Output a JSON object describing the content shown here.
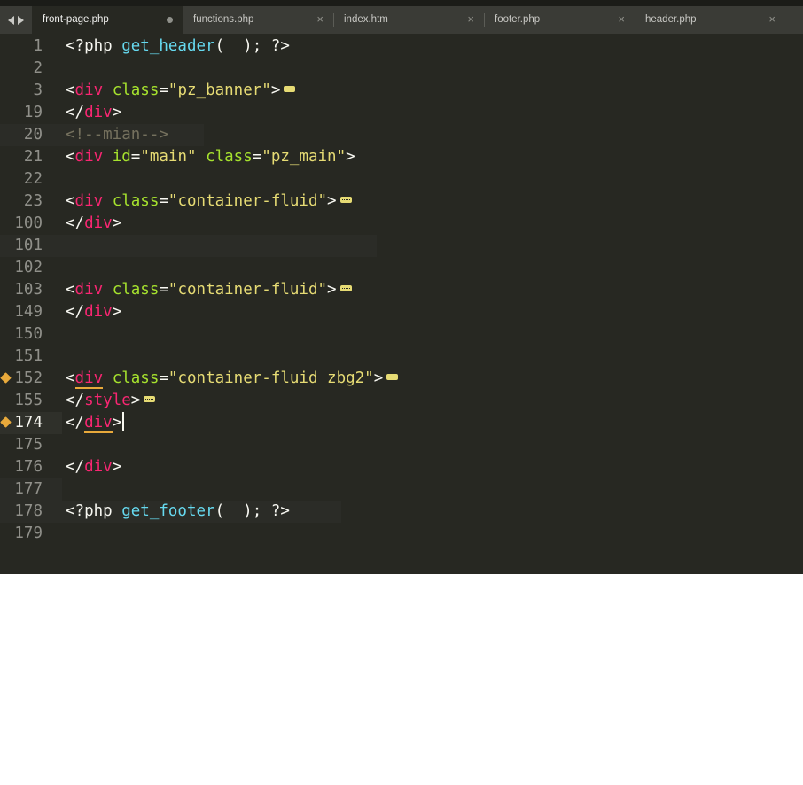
{
  "tabs": [
    {
      "label": "front-page.php",
      "active": true,
      "modified": true
    },
    {
      "label": "functions.php",
      "active": false,
      "modified": false
    },
    {
      "label": "index.htm",
      "active": false,
      "modified": false
    },
    {
      "label": "footer.php",
      "active": false,
      "modified": false
    },
    {
      "label": "header.php",
      "active": false,
      "modified": false
    }
  ],
  "close_glyph": "×",
  "line_numbers": [
    "1",
    "2",
    "3",
    "19",
    "20",
    "21",
    "22",
    "23",
    "100",
    "101",
    "102",
    "103",
    "149",
    "150",
    "151",
    "152",
    "155",
    "174",
    "175",
    "176",
    "177",
    "178",
    "179"
  ],
  "code": {
    "l1": {
      "open": "<?php ",
      "fn": "get_header",
      "rest": "(  ); ?>"
    },
    "l3": {
      "lt": "<",
      "tag": "div",
      "attr": " class",
      "eq": "=",
      "str": "\"pz_banner\"",
      "gt": ">"
    },
    "l19": {
      "lt": "</",
      "tag": "div",
      "gt": ">"
    },
    "l20": {
      "comment": "<!--mian-->"
    },
    "l21": {
      "lt": "<",
      "tag": "div",
      "attr1": " id",
      "eq1": "=",
      "str1": "\"main\"",
      "attr2": " class",
      "eq2": "=",
      "str2": "\"pz_main\"",
      "gt": ">"
    },
    "l23": {
      "lt": "<",
      "tag": "div",
      "attr": " class",
      "eq": "=",
      "str": "\"container-fluid\"",
      "gt": ">"
    },
    "l100": {
      "lt": "</",
      "tag": "div",
      "gt": ">"
    },
    "l103": {
      "lt": "<",
      "tag": "div",
      "attr": " class",
      "eq": "=",
      "str": "\"container-fluid\"",
      "gt": ">"
    },
    "l149": {
      "lt": "</",
      "tag": "div",
      "gt": ">"
    },
    "l152": {
      "lt": "<",
      "tag": "div",
      "attr": " class",
      "eq": "=",
      "str": "\"container-fluid zbg2\"",
      "gt": ">"
    },
    "l155": {
      "lt": "</",
      "tag": "style",
      "gt": ">"
    },
    "l174": {
      "lt": "</",
      "tag": "div",
      "gt": ">"
    },
    "l176": {
      "lt": "</",
      "tag": "div",
      "gt": ">"
    },
    "l178": {
      "open": "<?php ",
      "fn": "get_footer",
      "rest": "(  ); ?>"
    }
  },
  "colors": {
    "background": "#272822",
    "tag": "#f92672",
    "attribute": "#a6e22e",
    "string": "#e6db74",
    "function": "#66d9ef",
    "comment": "#75715e",
    "bookmark": "#e8a93b"
  }
}
